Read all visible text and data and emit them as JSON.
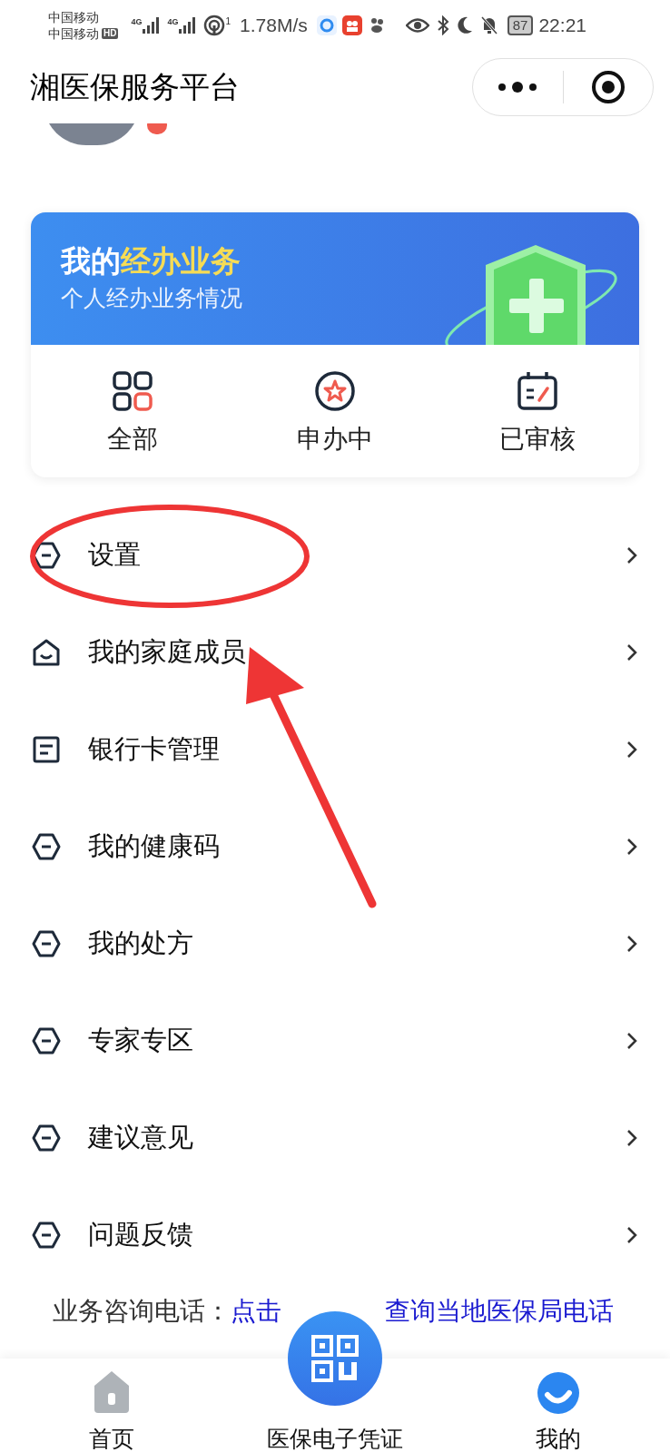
{
  "status_bar": {
    "carrier_1": "中国移动",
    "carrier_2": "中国移动",
    "hd_badge": "HD",
    "network_1": "4G",
    "network_2": "4G",
    "hotspot_count": "1",
    "speed": "1.78M/s",
    "battery": "87",
    "time": "22:21"
  },
  "header": {
    "title": "湘医保服务平台"
  },
  "business_card": {
    "title_plain": "我的",
    "title_highlight": "经办业务",
    "subtitle": "个人经办业务情况",
    "actions": [
      {
        "kind": "grid",
        "label": "全部"
      },
      {
        "kind": "star",
        "label": "申办中"
      },
      {
        "kind": "calendar",
        "label": "已审核"
      }
    ]
  },
  "menu": [
    {
      "kind": "hexagon",
      "label": "设置"
    },
    {
      "kind": "house",
      "label": "我的家庭成员"
    },
    {
      "kind": "card",
      "label": "银行卡管理"
    },
    {
      "kind": "hexagon",
      "label": "我的健康码"
    },
    {
      "kind": "hexagon",
      "label": "我的处方"
    },
    {
      "kind": "hexagon",
      "label": "专家专区"
    },
    {
      "kind": "hexagon",
      "label": "建议意见"
    },
    {
      "kind": "hexagon",
      "label": "问题反馈"
    }
  ],
  "hotline": {
    "label": "业务咨询电话：",
    "link_start": "点击",
    "link_end": "查询当地医保局电话"
  },
  "tab_bar": [
    {
      "kind": "home",
      "label": "首页",
      "selected": false
    },
    {
      "kind": "qr",
      "label": "医保电子凭证",
      "selected": false
    },
    {
      "kind": "mine",
      "label": "我的",
      "selected": true
    }
  ]
}
